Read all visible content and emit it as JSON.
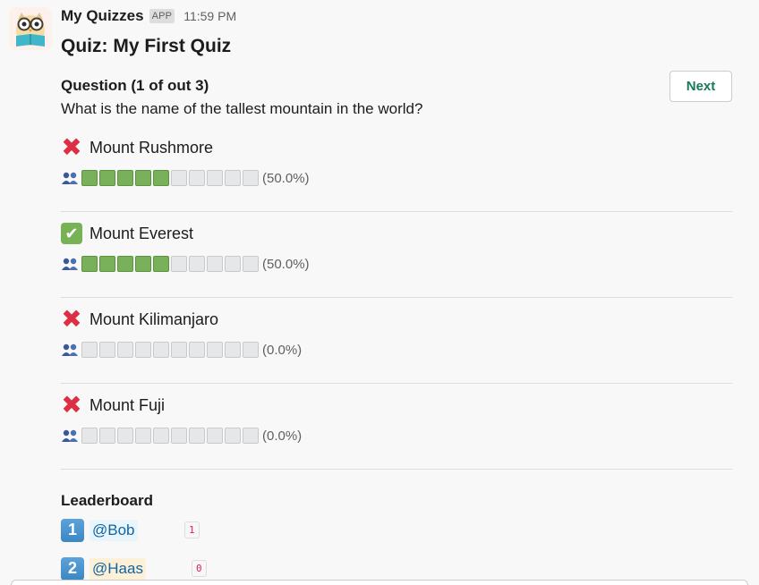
{
  "message": {
    "app_name": "My Quizzes",
    "app_badge": "APP",
    "timestamp": "11:59 PM",
    "avatar_icon": "owl-reading-book-icon"
  },
  "quiz": {
    "title": "Quiz: My First Quiz",
    "question_heading": "Question (1 of out 3)",
    "question_text": "What is the name of the tallest mountain in the world?",
    "next_label": "Next"
  },
  "options": [
    {
      "label": "Mount Rushmore",
      "correct": false,
      "icon": "cross-mark-icon",
      "filled_cells": 5,
      "total_cells": 10,
      "percent": "(50.0%)"
    },
    {
      "label": "Mount Everest",
      "correct": true,
      "icon": "check-mark-icon",
      "filled_cells": 5,
      "total_cells": 10,
      "percent": "(50.0%)"
    },
    {
      "label": "Mount Kilimanjaro",
      "correct": false,
      "icon": "cross-mark-icon",
      "filled_cells": 0,
      "total_cells": 10,
      "percent": "(0.0%)"
    },
    {
      "label": "Mount Fuji",
      "correct": false,
      "icon": "cross-mark-icon",
      "filled_cells": 0,
      "total_cells": 10,
      "percent": "(0.0%)"
    }
  ],
  "leaderboard": {
    "title": "Leaderboard",
    "entries": [
      {
        "rank": "1",
        "user": "@Bob",
        "score": "1"
      },
      {
        "rank": "2",
        "user": "@Haas",
        "score": "0"
      }
    ]
  },
  "colors": {
    "bar_filled": "#78b159",
    "bar_empty": "#e6e7e8",
    "next_text": "#157a5a",
    "mention_text": "#1264a3",
    "score_text": "#e01e5a",
    "rank_badge": "#3b88c3"
  }
}
